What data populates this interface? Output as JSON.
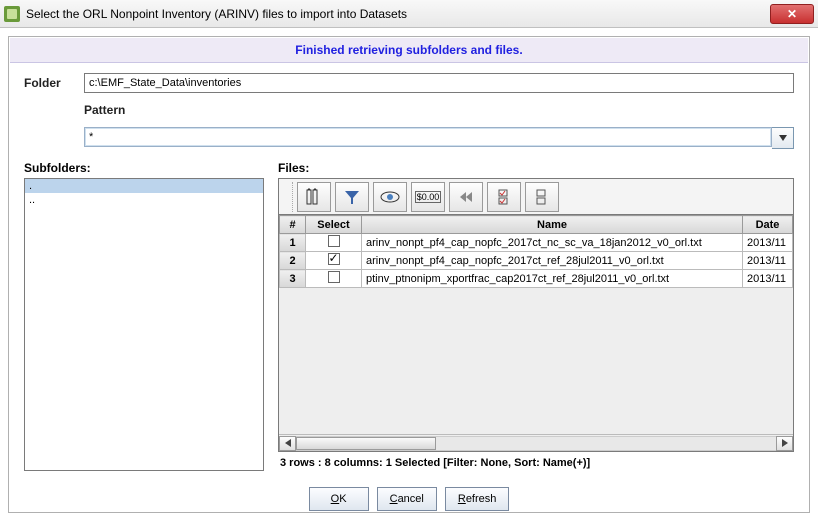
{
  "window": {
    "title": "Select the ORL Nonpoint Inventory (ARINV) files to import into Datasets",
    "close_glyph": "✕"
  },
  "status_message": "Finished retrieving subfolders and files.",
  "form": {
    "folder_label": "Folder",
    "folder_value": "c:\\EMF_State_Data\\inventories",
    "pattern_label": "Pattern",
    "pattern_value": "*"
  },
  "subfolders": {
    "label": "Subfolders:",
    "items": [
      ".",
      ".."
    ]
  },
  "files": {
    "label": "Files:",
    "columns": {
      "rownum": "#",
      "select": "Select",
      "name": "Name",
      "date": "Date"
    },
    "rows": [
      {
        "n": "1",
        "selected": false,
        "name": "arinv_nonpt_pf4_cap_nopfc_2017ct_nc_sc_va_18jan2012_v0_orl.txt",
        "date": "2013/11"
      },
      {
        "n": "2",
        "selected": true,
        "name": "arinv_nonpt_pf4_cap_nopfc_2017ct_ref_28jul2011_v0_orl.txt",
        "date": "2013/11"
      },
      {
        "n": "3",
        "selected": false,
        "name": "ptinv_ptnonipm_xportfrac_cap2017ct_ref_28jul2011_v0_orl.txt",
        "date": "2013/11"
      }
    ],
    "status": "3 rows : 8 columns: 1 Selected [Filter: None, Sort: Name(+)]"
  },
  "toolbar_icons": [
    "columns-icon",
    "filter-icon",
    "view-icon",
    "format-icon",
    "first-icon",
    "select-all-icon",
    "select-none-icon"
  ],
  "buttons": {
    "ok_mnemonic": "O",
    "ok_rest": "K",
    "cancel_mnemonic": "C",
    "cancel_rest": "ancel",
    "refresh_mnemonic": "R",
    "refresh_rest": "efresh"
  }
}
